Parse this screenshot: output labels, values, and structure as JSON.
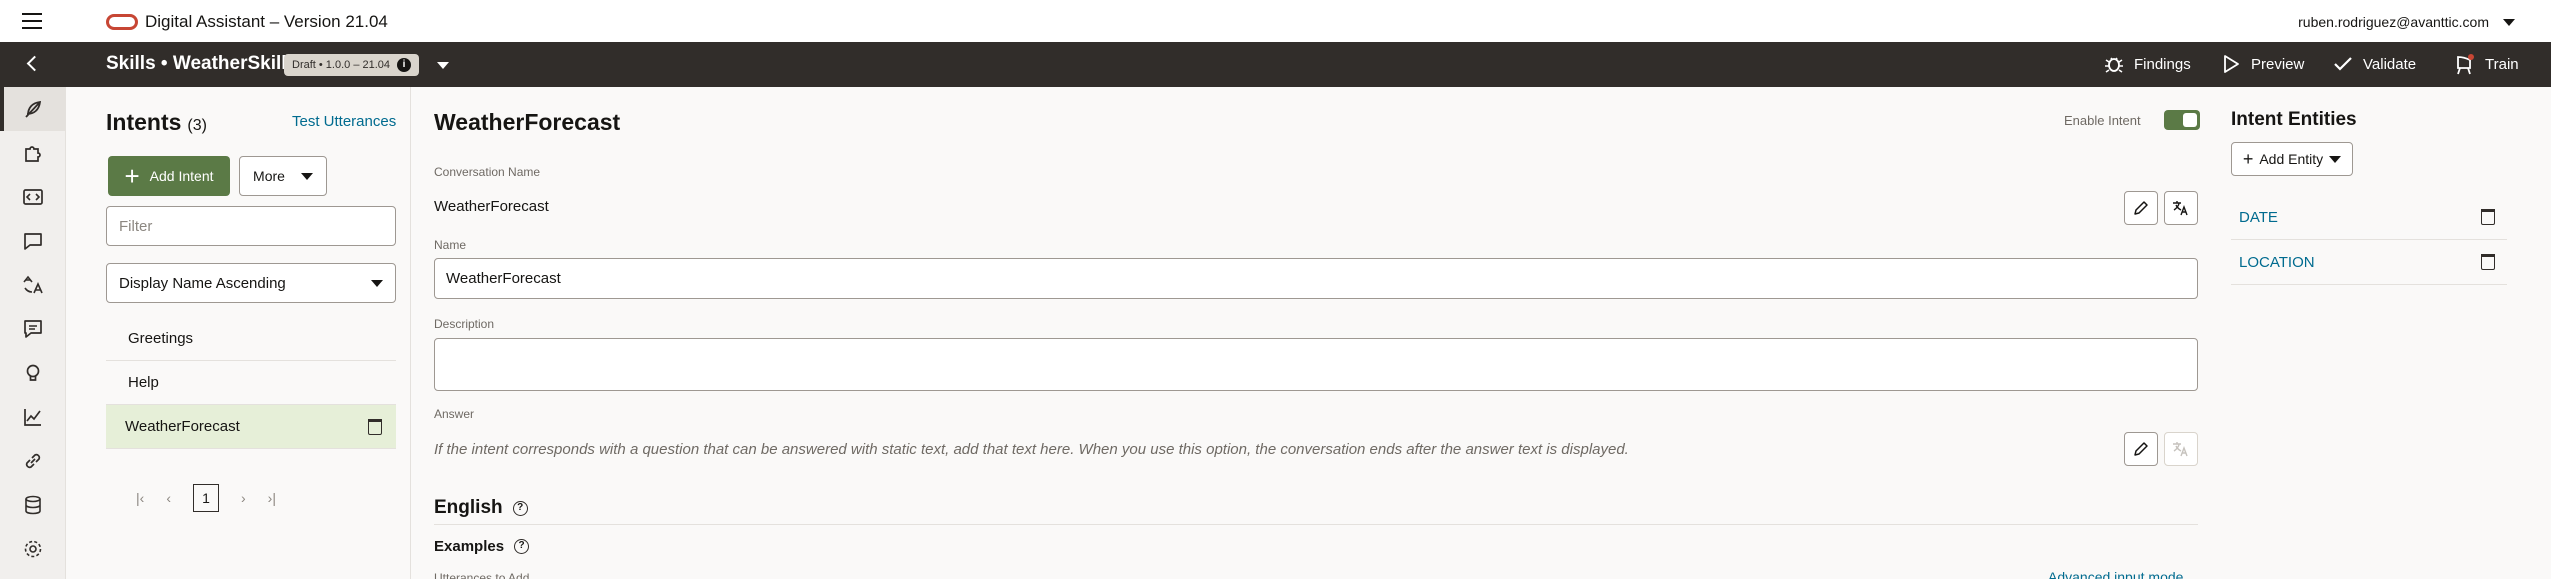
{
  "app": {
    "title": "Digital Assistant – Version 21.04",
    "user": "ruben.rodriguez@avanttic.com"
  },
  "header": {
    "title": "Skills • WeatherSkill",
    "version_badge": "Draft • 1.0.0 – 21.04",
    "actions": [
      {
        "label": "Findings",
        "icon": "bug-icon"
      },
      {
        "label": "Preview",
        "icon": "play-icon"
      },
      {
        "label": "Validate",
        "icon": "check-icon"
      },
      {
        "label": "Train",
        "icon": "train-icon"
      }
    ]
  },
  "rail": {
    "items": [
      {
        "name": "intents",
        "icon": "feather-icon",
        "active": true
      },
      {
        "name": "entities",
        "icon": "puzzle-icon"
      },
      {
        "name": "flows",
        "icon": "code-icon"
      },
      {
        "name": "resource-bundles",
        "icon": "chat-icon"
      },
      {
        "name": "settings-translate",
        "icon": "translate-icon"
      },
      {
        "name": "quality",
        "icon": "message-icon"
      },
      {
        "name": "insights",
        "icon": "bulb-icon"
      },
      {
        "name": "analytics",
        "icon": "chart-icon"
      },
      {
        "name": "components",
        "icon": "link-icon"
      },
      {
        "name": "data",
        "icon": "database-icon"
      },
      {
        "name": "settings",
        "icon": "gear-icon"
      }
    ]
  },
  "intents": {
    "title": "Intents",
    "count": "(3)",
    "test_link": "Test Utterances",
    "add_label": "Add Intent",
    "more_label": "More",
    "filter_placeholder": "Filter",
    "sort_value": "Display Name Ascending",
    "items": [
      {
        "label": "Greetings"
      },
      {
        "label": "Help"
      },
      {
        "label": "WeatherForecast"
      }
    ],
    "page": "1"
  },
  "main": {
    "title": "WeatherForecast",
    "enable_label": "Enable Intent",
    "enabled": true,
    "conversation_name_label": "Conversation Name",
    "conversation_name": "WeatherForecast",
    "name_label": "Name",
    "name_value": "WeatherForecast",
    "description_label": "Description",
    "description_value": "",
    "answer_label": "Answer",
    "answer_hint": "If the intent corresponds with a question that can be answered with static text, add that text here. When you use this option, the conversation ends after the answer text is displayed.",
    "language_title": "English",
    "examples_title": "Examples",
    "utterances_label": "Utterances to Add",
    "advanced_link": "Advanced input mode"
  },
  "entities": {
    "title": "Intent Entities",
    "add_label": "Add Entity",
    "items": [
      {
        "label": "DATE"
      },
      {
        "label": "LOCATION"
      }
    ]
  },
  "colors": {
    "accent": "#5b7a46",
    "header": "#312d2a",
    "link": "#006b8f",
    "brand": "#c74634"
  }
}
